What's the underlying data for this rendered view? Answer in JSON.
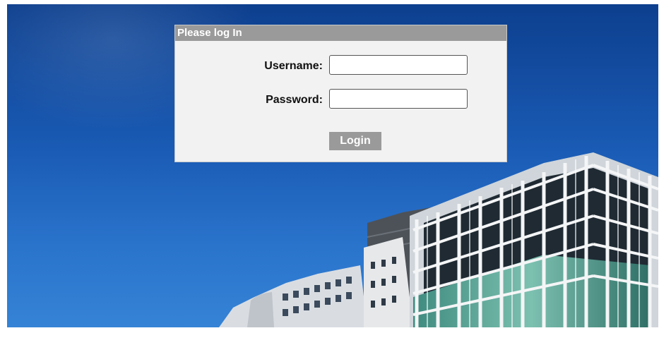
{
  "login": {
    "title": "Please log In",
    "username_label": "Username:",
    "username_value": "",
    "password_label": "Password:",
    "password_value": "",
    "submit_label": "Login"
  },
  "background": {
    "sky_colors": [
      "#0d3f8e",
      "#3583d6"
    ],
    "panel_header_color": "#9a9a9a",
    "panel_body_color": "#f2f2f2"
  }
}
